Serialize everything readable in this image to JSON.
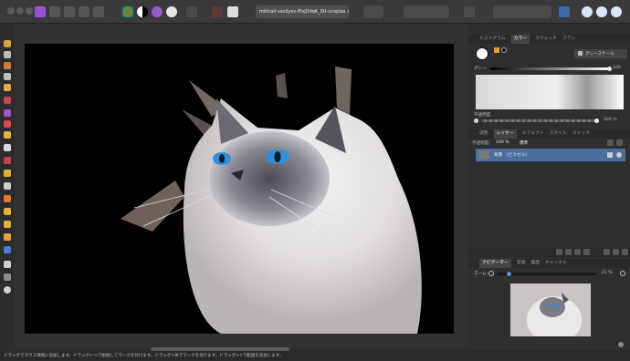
{
  "window": {
    "document_title": "mikhail-vasilyev-IFxjDdqK_0U-unsplas ×"
  },
  "colors": {
    "accent": "#4c6e9c",
    "toolbar_bg": "#3a3a3a",
    "panel_bg": "#2f2f2f",
    "canvas_bg": "#000000"
  },
  "panel": {
    "color_tabs": [
      "ヒストグラム",
      "カラー",
      "スウォッチ",
      "ブラシ"
    ],
    "color_tab_active": 1,
    "grayscale_button": "グレースケール",
    "gray_label": "グレー",
    "gray_value": "100",
    "opacity_label": "不透明度",
    "opacity_value": "100 %",
    "layer_tabs": [
      "調整",
      "レイヤー",
      "エフェクト",
      "スタイル",
      "ストック"
    ],
    "layer_tab_active": 1,
    "layer_opacity_label": "不透明度:",
    "layer_opacity_value": "100 %",
    "blend_mode": "標準",
    "layer_name": "背景",
    "layer_kind": "(ピクセル)",
    "nav_tabs": [
      "ナビゲーター",
      "変換",
      "履歴",
      "チャンネル"
    ],
    "nav_tab_active": 0,
    "zoom_label": "ズーム:",
    "zoom_value": "21 %"
  },
  "status": {
    "text": "ドラッグでマウス領域に追加します。ドラッグ+⌥で削除してマークを付けます。ドラッグ+⌘でマークを付けます。ドラッグ+⇧で範囲を追加します。"
  },
  "icons": {
    "toolbar": [
      "affinity-photo-icon",
      "persona-photo-icon",
      "persona-liquify-icon",
      "persona-develop-icon",
      "persona-tone-icon",
      "share-icon"
    ],
    "tools": [
      "move-tool-icon",
      "selection-tool-icon",
      "crop-tool-icon",
      "brush-tool-icon",
      "paint-tool-icon",
      "eraser-tool-icon",
      "clone-tool-icon",
      "text-tool-icon",
      "zoom-tool-icon"
    ]
  }
}
